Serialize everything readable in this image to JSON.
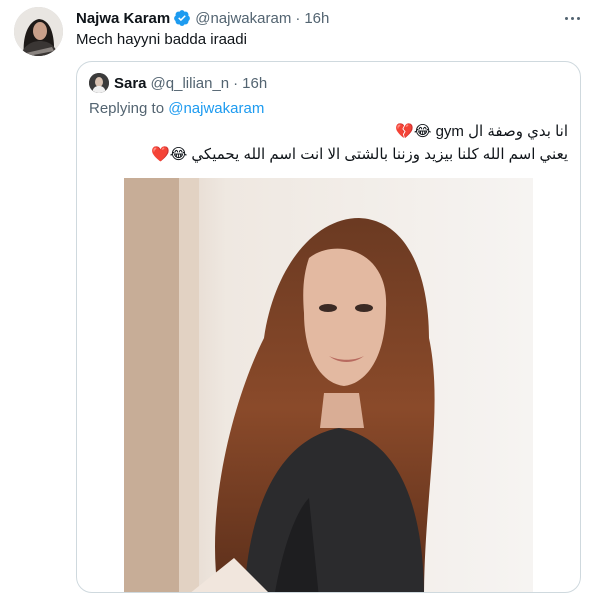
{
  "tweet": {
    "author_name": "Najwa Karam",
    "handle": "@najwakaram",
    "separator": "·",
    "time": "16h",
    "text": "Mech hayyni badda iraadi"
  },
  "quoted": {
    "author_name": "Sara",
    "handle": "@q_lilian_n",
    "separator": "·",
    "time": "16h",
    "replying_prefix": "Replying to",
    "replying_to": "@najwakaram",
    "line1": "انا بدي وصفة ال gym 😂💔",
    "line2": "يعني اسم الله كلنا بيزيد وزننا بالشتى الا انت اسم الله يحميكي 😂❤️"
  },
  "icons": {
    "verified": "verified-badge-icon",
    "more": "more-options-icon"
  },
  "colors": {
    "link": "#1d9bf0",
    "secondary_text": "#536471",
    "border": "#cfd9de"
  }
}
